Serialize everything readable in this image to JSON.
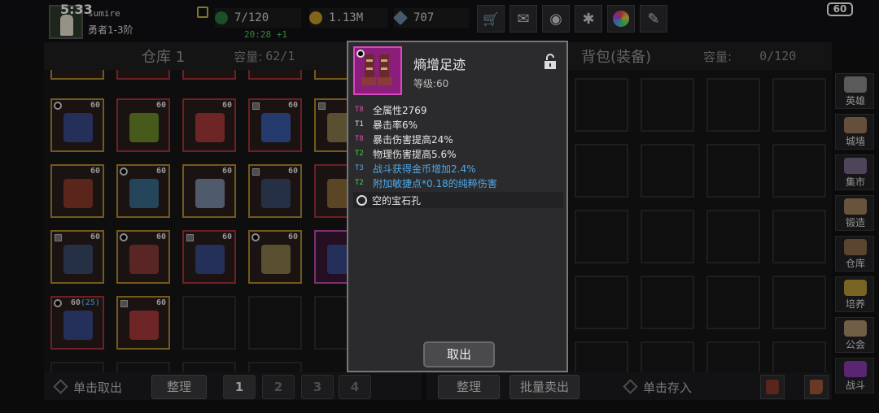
{
  "status": {
    "clock": "5:33",
    "battery": "60"
  },
  "player": {
    "name": "sumire",
    "rank": "勇者1-3阶"
  },
  "stats": {
    "energy": "7/120",
    "energy_regen": "20:28 +1",
    "gold": "1.13M",
    "gems": "707"
  },
  "warehouse": {
    "title": "仓库 1",
    "capacity_label": "容量:",
    "capacity_value": "62/1",
    "items": [
      {
        "level": "60",
        "mark": "dot",
        "frame": "gold",
        "kind": "boots"
      },
      {
        "level": "60",
        "mark": "",
        "frame": "red",
        "kind": "amulet"
      },
      {
        "level": "60",
        "mark": "",
        "frame": "red",
        "kind": "axe"
      },
      {
        "level": "60",
        "mark": "lock",
        "frame": "red",
        "kind": "necklace"
      },
      {
        "level": "",
        "mark": "lock",
        "frame": "gold",
        "kind": "armor"
      },
      {
        "level": "60",
        "mark": "",
        "frame": "gold",
        "kind": "hat"
      },
      {
        "level": "60",
        "mark": "dot",
        "frame": "gold",
        "kind": "bracer"
      },
      {
        "level": "60",
        "mark": "",
        "frame": "gold",
        "kind": "sword"
      },
      {
        "level": "60",
        "mark": "lock",
        "frame": "gold",
        "kind": "pants"
      },
      {
        "level": "",
        "mark": "",
        "frame": "red",
        "kind": "misc"
      },
      {
        "level": "60",
        "mark": "lock",
        "frame": "gold",
        "kind": "pants"
      },
      {
        "level": "60",
        "mark": "dot",
        "frame": "gold",
        "kind": "staff"
      },
      {
        "level": "60",
        "mark": "lock",
        "frame": "red",
        "kind": "boots"
      },
      {
        "level": "60",
        "mark": "dot",
        "frame": "gold",
        "kind": "armor"
      },
      {
        "level": "",
        "mark": "",
        "frame": "pink",
        "kind": "boots"
      },
      {
        "level": "60",
        "extra": "(25)",
        "mark": "dot",
        "frame": "red",
        "kind": "boots"
      },
      {
        "level": "60",
        "mark": "lock",
        "frame": "gold",
        "kind": "axe"
      }
    ]
  },
  "bag": {
    "title": "背包(装备)",
    "capacity_label": "容量:",
    "capacity_value": "0/120"
  },
  "popup": {
    "title": "熵增足迹",
    "level": "等级:60",
    "attributes": [
      {
        "tier": "T8",
        "text": "全属性2769",
        "tier_color": "#e84ab0",
        "blue": false
      },
      {
        "tier": "T1",
        "text": "暴击率6%",
        "tier_color": "#dddddd",
        "blue": false
      },
      {
        "tier": "T8",
        "text": "暴击伤害提高24%",
        "tier_color": "#e84ab0",
        "blue": false
      },
      {
        "tier": "T2",
        "text": "物理伤害提高5.6%",
        "tier_color": "#4bd04b",
        "blue": false
      },
      {
        "tier": "T3",
        "text": "战斗获得金币增加2.4%",
        "tier_color": "#4fa8e8",
        "blue": true
      },
      {
        "tier": "T2",
        "text": "附加敏捷点*0.18的纯粹伤害",
        "tier_color": "#4bd04b",
        "blue": true
      }
    ],
    "gem_socket": "空的宝石孔",
    "cancel": "取出"
  },
  "bottom": {
    "take_out": "单击取出",
    "sort_left": "整理",
    "pages": [
      "1",
      "2",
      "3",
      "4"
    ],
    "sort_right": "整理",
    "bulk_sell": "批量卖出",
    "store": "单击存入"
  },
  "sidenav": [
    {
      "label": "英雄",
      "color": "#8a8a8a"
    },
    {
      "label": "城墙",
      "color": "#9a7a5a"
    },
    {
      "label": "集市",
      "color": "#7a6a8a"
    },
    {
      "label": "锻造",
      "color": "#a0825a"
    },
    {
      "label": "仓库",
      "color": "#8a6a4a"
    },
    {
      "label": "培养",
      "color": "#b89a3a"
    },
    {
      "label": "公会",
      "color": "#b0906a"
    },
    {
      "label": "战斗",
      "color": "#8a3ab0"
    }
  ],
  "colors": {
    "background": "#111113",
    "gold_frame": "#b08a2a",
    "red_frame": "#a8323a",
    "accent_pink": "#d84ac0",
    "attr_blue": "#4fa8e8"
  }
}
